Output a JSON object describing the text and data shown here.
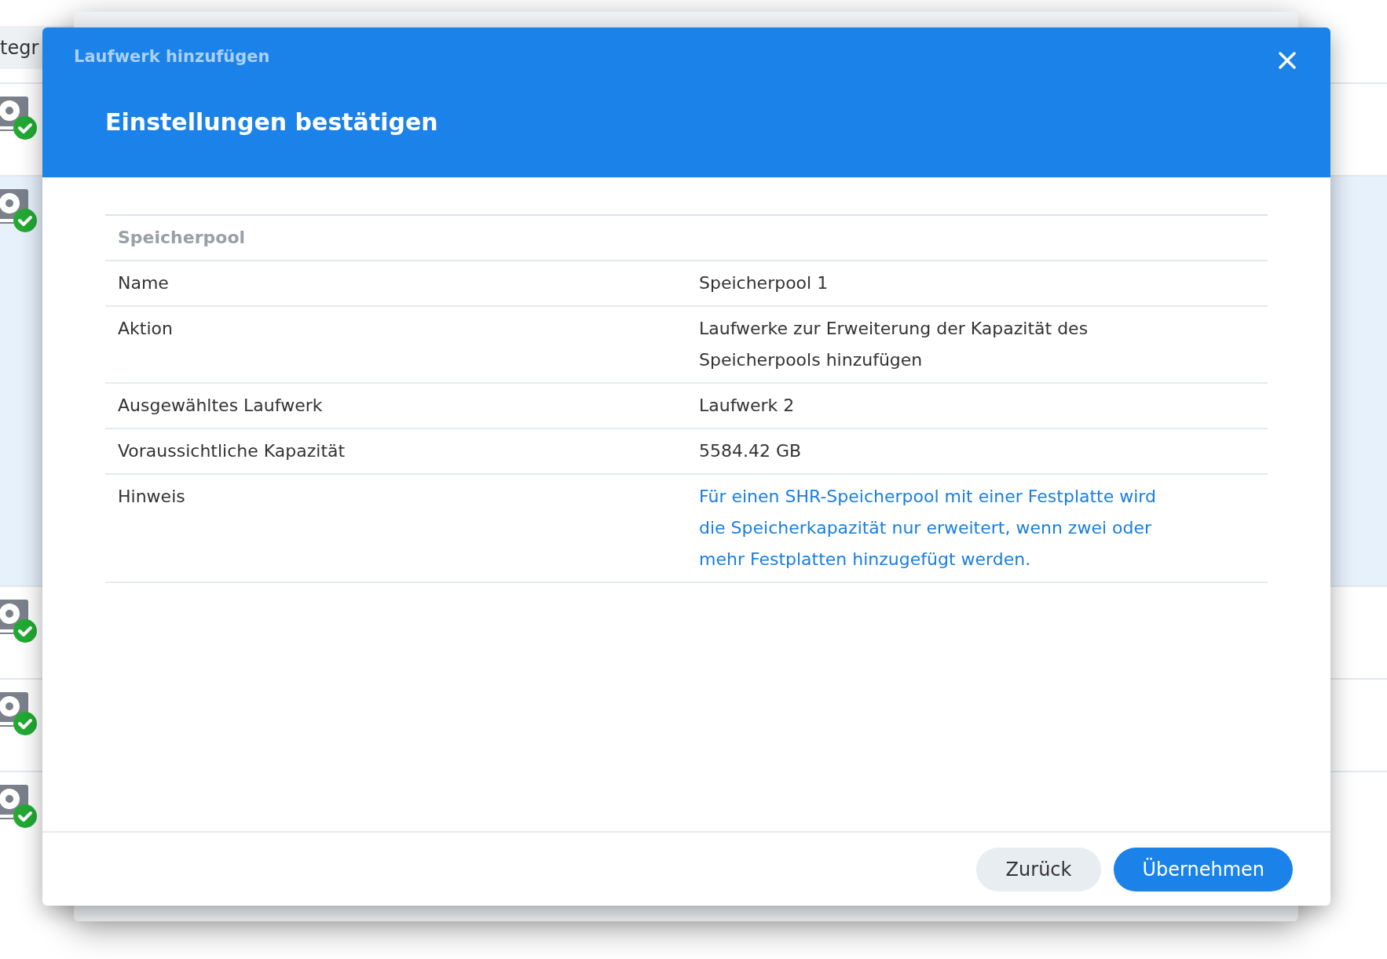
{
  "background": {
    "header_text": "tegr",
    "rows": [
      {
        "selected": false
      },
      {
        "selected": true
      },
      {
        "selected": false
      },
      {
        "selected": false
      },
      {
        "selected": false
      }
    ]
  },
  "dialog": {
    "wizard_title": "Laufwerk hinzufügen",
    "step_title": "Einstellungen bestätigen",
    "section": "Speicherpool",
    "rows": [
      {
        "label": "Name",
        "value": "Speicherpool 1",
        "kind": "text"
      },
      {
        "label": "Aktion",
        "value": "Laufwerke zur Erweiterung der Kapazität des Speicherpools hinzufügen",
        "kind": "text"
      },
      {
        "label": "Ausgewähltes Laufwerk",
        "value": "Laufwerk 2",
        "kind": "text"
      },
      {
        "label": "Voraussichtliche Kapazität",
        "value": "5584.42 GB",
        "kind": "text"
      },
      {
        "label": "Hinweis",
        "value": "Für einen SHR-Speicherpool mit einer Festplatte wird die Speicherkapazität nur erweitert, wenn zwei oder mehr Festplatten hinzugefügt werden.",
        "kind": "note"
      }
    ],
    "buttons": [
      {
        "label": "Zurück",
        "kind": "secondary"
      },
      {
        "label": "Übernehmen",
        "kind": "primary"
      }
    ]
  }
}
